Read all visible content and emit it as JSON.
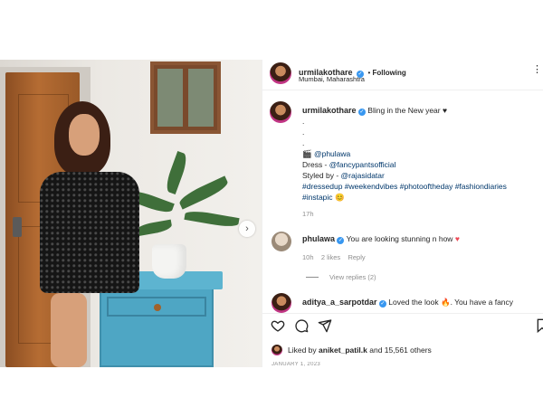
{
  "author": {
    "username": "urmilakothare",
    "location": "Mumbai, Maharashtra",
    "follow_state": "Following",
    "more": "⋮"
  },
  "caption": {
    "text": "Bling in the New year",
    "dots": [
      ".",
      ".",
      "."
    ],
    "camera_emoji": "🎬",
    "photo_credit": "@phulawa",
    "dress_label": "Dress - ",
    "dress_credit": "@fancypantsofficial",
    "styled_label": "Styled by - ",
    "styled_credit": "@rajasidatar",
    "hashtags_1": "#dressedup #weekendvibes #photooftheday #fashiondiaries",
    "hashtags_2": "#instapic",
    "time": "17h"
  },
  "comments": [
    {
      "username": "phulawa",
      "text": "You are looking stunning n how",
      "time": "10h",
      "likes": "2 likes",
      "reply": "Reply",
      "view_replies": "View replies (2)"
    },
    {
      "username": "aditya_a_sarpotdar",
      "text": "Loved the look",
      "text_more": ". You have a fancy"
    }
  ],
  "likes": {
    "prefix": "Liked by ",
    "user": "aniket_patil.k",
    "suffix": " and 15,561 others"
  },
  "date_partial": "JANUARY 1, 2023",
  "icons": [
    "heart-outline-icon",
    "comment-icon",
    "share-icon",
    "bookmark-icon",
    "verified-icon",
    "next-icon"
  ],
  "colors": {
    "accent": "#3897f0",
    "link": "#00376b",
    "muted": "#8e8e8e",
    "like_red": "#ed4956"
  }
}
